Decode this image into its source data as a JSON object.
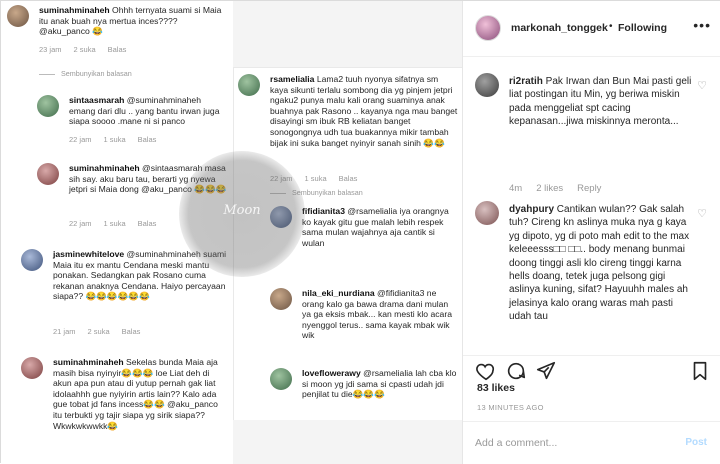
{
  "post": {
    "username": "markonah_tonggek",
    "follow_separator": "•",
    "follow_label": "Following",
    "more_label": "•••",
    "likes": "83 likes",
    "time": "13 MINUTES AGO",
    "add_comment_placeholder": "Add a comment...",
    "post_label": "Post"
  },
  "side_comments": [
    {
      "user": "ri2ratih",
      "text": " Pak Irwan dan Bun Mai pasti geli liat postingan itu Min, yg beriwa miskin pada menggeliat spt cacing kepanasan...jiwa miskinnya meronta...",
      "time": "4m",
      "likes": "2 likes",
      "reply": "Reply"
    },
    {
      "user": "dyahpury",
      "text": " Cantikan wulan?? Gak salah tuh? Cireng kn aslinya muka nya g kaya yg dipoto, yg di poto mah edit to the max keleeesss□□ □□.. body menang bunmai doong tinggi asli klo cireng tinggi karna hells doang, tetek juga pelsong gigi aslinya kuning, sifat? Hayuuhh males ah jelasinya kalo orang waras mah pasti udah tau",
      "time": "",
      "likes": "",
      "reply": ""
    }
  ],
  "screenshot_comments": {
    "c1": {
      "user": "suminahminaheh",
      "text": " Ohhh ternyata suami si Maia itu anak buah nya mertua inces???? @aku_panco 😂",
      "time": "23 jam",
      "likes": "2 suka",
      "reply": "Balas"
    },
    "hide1": "Sembunyikan balasan",
    "c2": {
      "user": "sintaasmarah",
      "text": " @suminahminaheh emang dari dlu .. yang bantu irwan juga siapa soooo .mane ni si panco",
      "time": "22 jam",
      "likes": "1 suka",
      "reply": "Balas"
    },
    "c3": {
      "user": "suminahminaheh",
      "text": " @sintaasmarah masa sih say. aku baru tau, berarti yg nyewa jetpri si Maia dong @aku_panco 😂😂😂",
      "time": "22 jam",
      "likes": "1 suka",
      "reply": "Balas"
    },
    "c4": {
      "user": "jasminewhitelove",
      "text": " @suminahminaheh suami Maia itu ex mantu Cendana meski mantu ponakan. Sedangkan pak Rosano cuma rekanan anaknya Cendana. Haiyo percayaan siapa?? 😂😂😂😂😂😂",
      "time": "21 jam",
      "likes": "2 suka",
      "reply": "Balas"
    },
    "c5": {
      "user": "suminahminaheh",
      "text": " Sekelas bunda Maia aja masih bisa nyinyir😂😂😂 loe Liat deh di akun apa pun atau di yutup pernah gak liat idolaahhh gue nyiyirin artis lain?? Kalo ada gue tobat jd fans incess😂😂 @aku_panco itu terbukti yg tajir siapa yg sirik siapa?? Wkwkwkwwkk😂",
      "time": "",
      "likes": "",
      "reply": ""
    },
    "c6": {
      "user": "rsamelialia",
      "text": " Lama2 tuuh nyonya sifatnya sm kaya sikunti terlalu sombong dia yg pinjem jetpri ngaku2 punya malu kali orang suaminya anak buahnya pak Rasono .. kayanya nga mau banget disayingi sm ibuk RB keliatan banget sonogongnya udh tua buakannya mikir tambah bijak ini suka banget nyinyir sanah sinih 😂😂",
      "time": "22 jam",
      "likes": "1 suka",
      "reply": "Balas"
    },
    "hide2": "Sembunyikan balasan",
    "c7": {
      "user": "fifidianita3",
      "text": " @rsamelialia iya orangnya ko kayak gitu gue malah lebih respek sama mulan wajahnya aja cantik si wulan",
      "time": "",
      "likes": "",
      "reply": ""
    },
    "c8": {
      "user": "nila_eki_nurdiana",
      "text": " @fifidianita3 ne orang kalo ga bawa drama dani mulan ya ga eksis mbak... kan mesti klo acara nyenggol terus.. sama kayak mbak wik wik",
      "time": "",
      "likes": "",
      "reply": ""
    },
    "c9": {
      "user": "loveflowerawy",
      "text": " @rsamelialia lah cba klo si moon yg jdi sama si cpasti udah jdi penjilat tu die😂😂😂",
      "time": "",
      "likes": "",
      "reply": ""
    },
    "watermark": "Moon"
  }
}
